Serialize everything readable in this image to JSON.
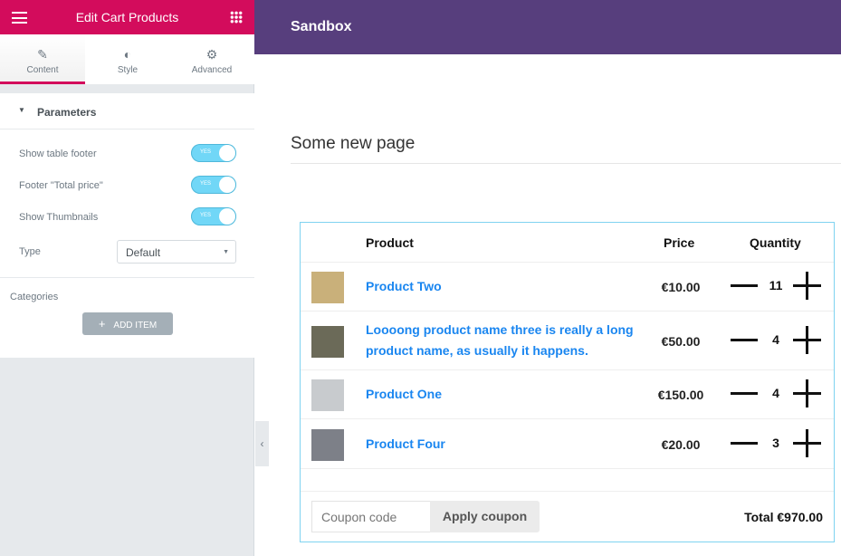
{
  "sidebar": {
    "title": "Edit Cart Products",
    "tabs": [
      {
        "label": "Content"
      },
      {
        "label": "Style"
      },
      {
        "label": "Advanced"
      }
    ],
    "section": "Parameters",
    "controls": [
      {
        "label": "Show table footer",
        "value": "YES"
      },
      {
        "label": "Footer \"Total price\"",
        "value": "YES"
      },
      {
        "label": "Show Thumbnails",
        "value": "YES"
      }
    ],
    "type_label": "Type",
    "type_value": "Default",
    "categories_label": "Categories",
    "add_item": "ADD ITEM"
  },
  "site": {
    "name": "Sandbox",
    "page_title": "Some new page"
  },
  "cart": {
    "headers": {
      "product": "Product",
      "price": "Price",
      "quantity": "Quantity"
    },
    "rows": [
      {
        "name": "Product Two",
        "price": "€10.00",
        "qty": "11",
        "thumb": "#c9b07a"
      },
      {
        "name": "Loooong product name three is really a long product name, as usually it happens.",
        "price": "€50.00",
        "qty": "4",
        "thumb": "#6b6a58"
      },
      {
        "name": "Product One",
        "price": "€150.00",
        "qty": "4",
        "thumb": "#c8cbce"
      },
      {
        "name": "Product Four",
        "price": "€20.00",
        "qty": "3",
        "thumb": "#7d8088"
      }
    ],
    "coupon_placeholder": "Coupon code",
    "apply": "Apply coupon",
    "total": "Total €970.00"
  }
}
